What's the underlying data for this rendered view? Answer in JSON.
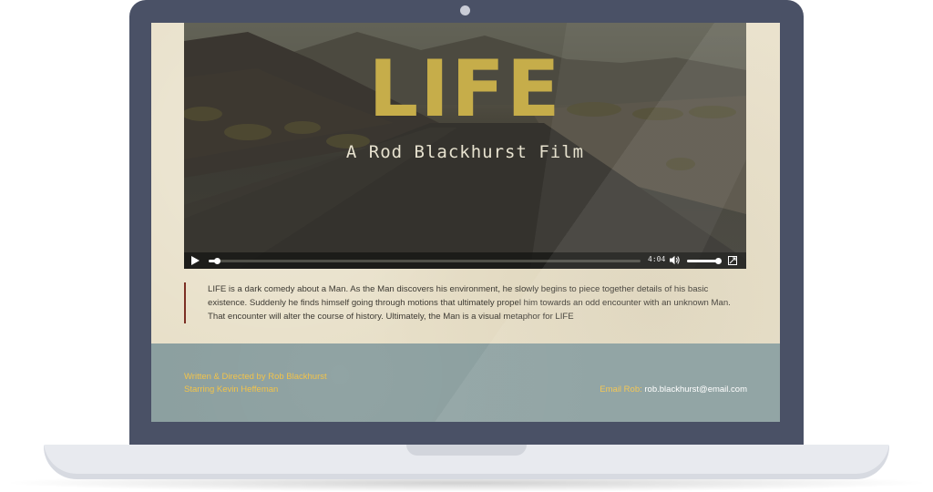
{
  "video": {
    "title": "LIFE",
    "subtitle": "A Rod Blackhurst Film",
    "time": "4:04",
    "progress": 0.02,
    "volume": 0.95
  },
  "description": {
    "text": "LIFE is a dark comedy about a Man. As the Man discovers his environment, he slowly begins to piece together details of his basic existence. Suddenly he finds himself going through motions that ultimately propel him towards an odd encounter with an unknown Man. That encounter will alter the course of history. Ultimately, the Man is a visual metaphor for LIFE"
  },
  "footer": {
    "credit_directed": "Written & Directed by Rob Blackhurst",
    "credit_starring": "Starring Kevin Heffeman",
    "contact_label": "Email Rob:",
    "contact_email": "rob.blackhurst@email.com"
  },
  "icons": {
    "play": "play-icon",
    "volume": "volume-icon",
    "fullscreen": "fullscreen-icon"
  },
  "colors": {
    "title_gold": "#c6ad4a",
    "credit_yellow": "#f2c34a",
    "footer_bg": "#8a9e9e",
    "quote_border": "#7b2f24",
    "laptop_frame": "#4a5166"
  }
}
